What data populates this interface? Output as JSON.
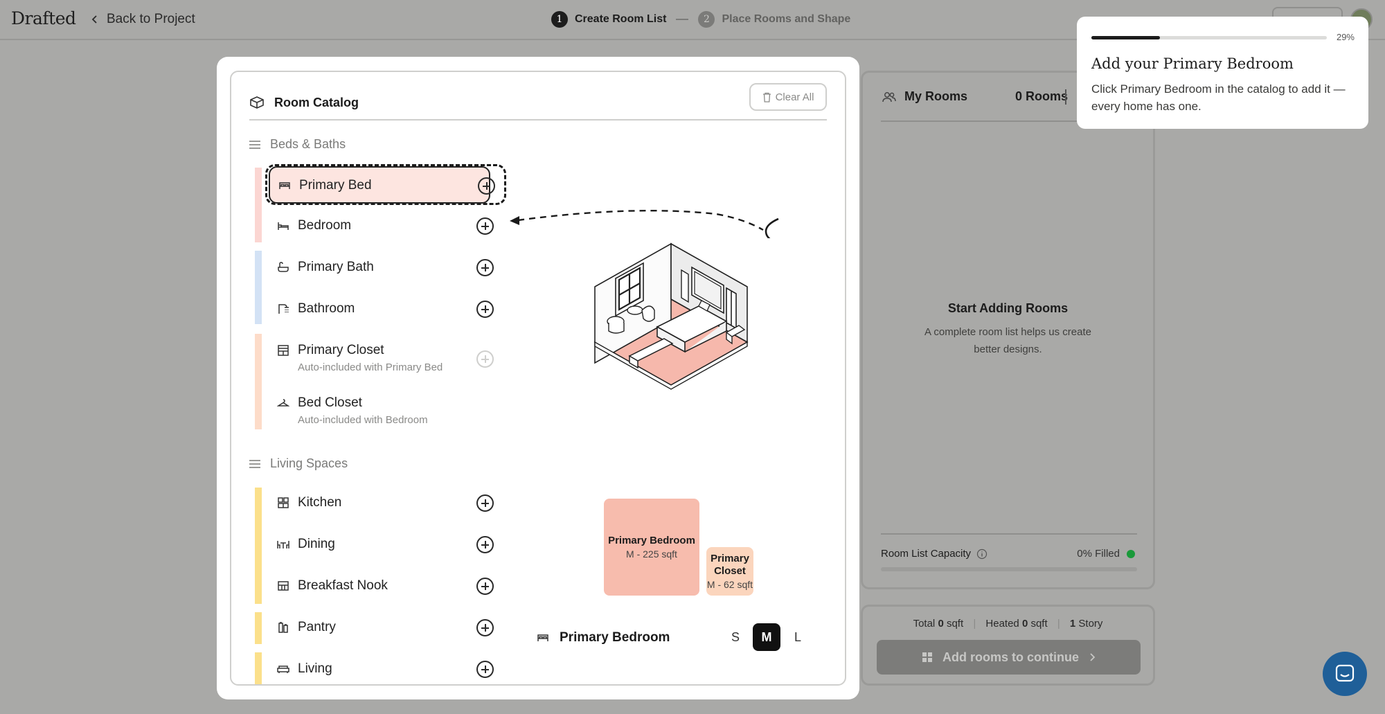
{
  "topbar": {
    "logo": "Drafted",
    "back_label": "Back to Project",
    "steps": [
      {
        "number": "1",
        "label": "Create Room List",
        "active": true
      },
      {
        "number": "2",
        "label": "Place Rooms and Shape",
        "active": false
      }
    ]
  },
  "catalog": {
    "title": "Room Catalog",
    "clear_label": "Clear All",
    "sections": [
      {
        "title": "Beds & Baths",
        "items": [
          {
            "label": "Primary Bed",
            "icon": "bed-icon",
            "selected": true
          },
          {
            "label": "Bedroom",
            "icon": "bed-icon"
          },
          {
            "label": "Primary Bath",
            "icon": "bathtub-icon"
          },
          {
            "label": "Bathroom",
            "icon": "shower-icon"
          },
          {
            "label": "Primary Closet",
            "sub": "Auto-included with Primary Bed",
            "icon": "closet-icon",
            "disabled": true
          },
          {
            "label": "Bed Closet",
            "sub": "Auto-included with Bedroom",
            "icon": "hanger-icon"
          }
        ]
      },
      {
        "title": "Living Spaces",
        "items": [
          {
            "label": "Kitchen",
            "icon": "kitchen-icon"
          },
          {
            "label": "Dining",
            "icon": "dining-icon"
          },
          {
            "label": "Breakfast Nook",
            "icon": "nook-icon"
          },
          {
            "label": "Pantry",
            "icon": "pantry-icon"
          },
          {
            "label": "Living",
            "icon": "sofa-icon"
          }
        ]
      }
    ],
    "colors": {
      "bed": "#fbd6d2",
      "bath": "#d3e2f5",
      "closet": "#fddcc9",
      "living": "#fbe08b"
    }
  },
  "preview": {
    "room_name": "Primary Bedroom",
    "sizes": [
      "S",
      "M",
      "L"
    ],
    "selected_size": "M",
    "tiles": [
      {
        "name": "Primary Bedroom",
        "detail": "M - 225 sqft",
        "color": "#f7bcad"
      },
      {
        "name": "Primary Closet",
        "detail": "M - 62 sqft",
        "color": "#fbd5bd"
      }
    ]
  },
  "my_rooms": {
    "title": "My Rooms",
    "count_label": "0 Rooms",
    "empty_title": "Start Adding Rooms",
    "empty_text": "A complete room list helps us create better designs.",
    "capacity_label": "Room List Capacity",
    "capacity_value": "0% Filled",
    "capacity_fraction": 0
  },
  "totals": {
    "total_label": "Total",
    "total_value": "0",
    "total_unit": "sqft",
    "heated_label": "Heated",
    "heated_value": "0",
    "heated_unit": "sqft",
    "story_value": "1",
    "story_label": "Story",
    "continue_label": "Add rooms to continue"
  },
  "tooltip": {
    "progress_percent": 29,
    "progress_label": "29%",
    "title": "Add your Primary Bedroom",
    "text": "Click Primary Bedroom in the catalog to add it — every home has one."
  }
}
